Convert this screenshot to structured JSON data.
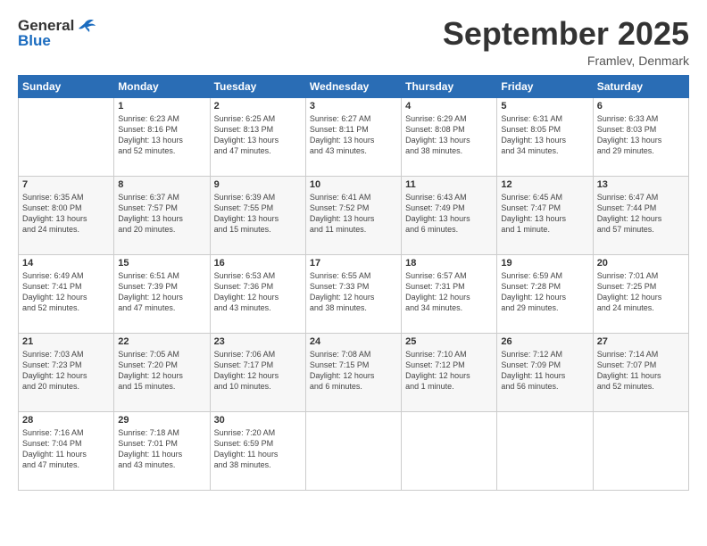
{
  "header": {
    "logo_general": "General",
    "logo_blue": "Blue",
    "month_title": "September 2025",
    "location": "Framlev, Denmark"
  },
  "days_of_week": [
    "Sunday",
    "Monday",
    "Tuesday",
    "Wednesday",
    "Thursday",
    "Friday",
    "Saturday"
  ],
  "weeks": [
    [
      {
        "day": "",
        "info": ""
      },
      {
        "day": "1",
        "info": "Sunrise: 6:23 AM\nSunset: 8:16 PM\nDaylight: 13 hours\nand 52 minutes."
      },
      {
        "day": "2",
        "info": "Sunrise: 6:25 AM\nSunset: 8:13 PM\nDaylight: 13 hours\nand 47 minutes."
      },
      {
        "day": "3",
        "info": "Sunrise: 6:27 AM\nSunset: 8:11 PM\nDaylight: 13 hours\nand 43 minutes."
      },
      {
        "day": "4",
        "info": "Sunrise: 6:29 AM\nSunset: 8:08 PM\nDaylight: 13 hours\nand 38 minutes."
      },
      {
        "day": "5",
        "info": "Sunrise: 6:31 AM\nSunset: 8:05 PM\nDaylight: 13 hours\nand 34 minutes."
      },
      {
        "day": "6",
        "info": "Sunrise: 6:33 AM\nSunset: 8:03 PM\nDaylight: 13 hours\nand 29 minutes."
      }
    ],
    [
      {
        "day": "7",
        "info": "Sunrise: 6:35 AM\nSunset: 8:00 PM\nDaylight: 13 hours\nand 24 minutes."
      },
      {
        "day": "8",
        "info": "Sunrise: 6:37 AM\nSunset: 7:57 PM\nDaylight: 13 hours\nand 20 minutes."
      },
      {
        "day": "9",
        "info": "Sunrise: 6:39 AM\nSunset: 7:55 PM\nDaylight: 13 hours\nand 15 minutes."
      },
      {
        "day": "10",
        "info": "Sunrise: 6:41 AM\nSunset: 7:52 PM\nDaylight: 13 hours\nand 11 minutes."
      },
      {
        "day": "11",
        "info": "Sunrise: 6:43 AM\nSunset: 7:49 PM\nDaylight: 13 hours\nand 6 minutes."
      },
      {
        "day": "12",
        "info": "Sunrise: 6:45 AM\nSunset: 7:47 PM\nDaylight: 13 hours\nand 1 minute."
      },
      {
        "day": "13",
        "info": "Sunrise: 6:47 AM\nSunset: 7:44 PM\nDaylight: 12 hours\nand 57 minutes."
      }
    ],
    [
      {
        "day": "14",
        "info": "Sunrise: 6:49 AM\nSunset: 7:41 PM\nDaylight: 12 hours\nand 52 minutes."
      },
      {
        "day": "15",
        "info": "Sunrise: 6:51 AM\nSunset: 7:39 PM\nDaylight: 12 hours\nand 47 minutes."
      },
      {
        "day": "16",
        "info": "Sunrise: 6:53 AM\nSunset: 7:36 PM\nDaylight: 12 hours\nand 43 minutes."
      },
      {
        "day": "17",
        "info": "Sunrise: 6:55 AM\nSunset: 7:33 PM\nDaylight: 12 hours\nand 38 minutes."
      },
      {
        "day": "18",
        "info": "Sunrise: 6:57 AM\nSunset: 7:31 PM\nDaylight: 12 hours\nand 34 minutes."
      },
      {
        "day": "19",
        "info": "Sunrise: 6:59 AM\nSunset: 7:28 PM\nDaylight: 12 hours\nand 29 minutes."
      },
      {
        "day": "20",
        "info": "Sunrise: 7:01 AM\nSunset: 7:25 PM\nDaylight: 12 hours\nand 24 minutes."
      }
    ],
    [
      {
        "day": "21",
        "info": "Sunrise: 7:03 AM\nSunset: 7:23 PM\nDaylight: 12 hours\nand 20 minutes."
      },
      {
        "day": "22",
        "info": "Sunrise: 7:05 AM\nSunset: 7:20 PM\nDaylight: 12 hours\nand 15 minutes."
      },
      {
        "day": "23",
        "info": "Sunrise: 7:06 AM\nSunset: 7:17 PM\nDaylight: 12 hours\nand 10 minutes."
      },
      {
        "day": "24",
        "info": "Sunrise: 7:08 AM\nSunset: 7:15 PM\nDaylight: 12 hours\nand 6 minutes."
      },
      {
        "day": "25",
        "info": "Sunrise: 7:10 AM\nSunset: 7:12 PM\nDaylight: 12 hours\nand 1 minute."
      },
      {
        "day": "26",
        "info": "Sunrise: 7:12 AM\nSunset: 7:09 PM\nDaylight: 11 hours\nand 56 minutes."
      },
      {
        "day": "27",
        "info": "Sunrise: 7:14 AM\nSunset: 7:07 PM\nDaylight: 11 hours\nand 52 minutes."
      }
    ],
    [
      {
        "day": "28",
        "info": "Sunrise: 7:16 AM\nSunset: 7:04 PM\nDaylight: 11 hours\nand 47 minutes."
      },
      {
        "day": "29",
        "info": "Sunrise: 7:18 AM\nSunset: 7:01 PM\nDaylight: 11 hours\nand 43 minutes."
      },
      {
        "day": "30",
        "info": "Sunrise: 7:20 AM\nSunset: 6:59 PM\nDaylight: 11 hours\nand 38 minutes."
      },
      {
        "day": "",
        "info": ""
      },
      {
        "day": "",
        "info": ""
      },
      {
        "day": "",
        "info": ""
      },
      {
        "day": "",
        "info": ""
      }
    ]
  ]
}
